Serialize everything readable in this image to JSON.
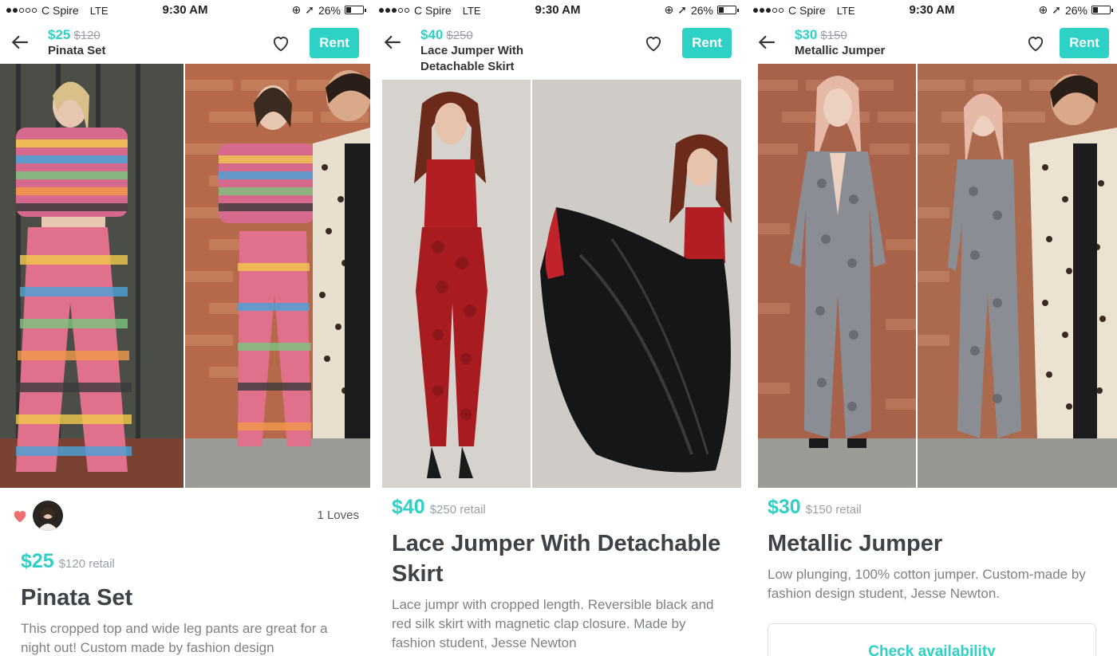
{
  "status_bar": {
    "carrier": "C Spire",
    "network": "LTE",
    "time": "9:30 AM",
    "battery": "26%",
    "battery_level": 0.26
  },
  "accent_color": "#2ed1c6",
  "screens": [
    {
      "nav": {
        "price": "$25",
        "retail": "$120",
        "name": "Pinata Set",
        "rent_label": "Rent"
      },
      "loves": {
        "count_label": "1 Loves"
      },
      "detail": {
        "price": "$25",
        "retail": "$120 retail",
        "title": "Pinata Set",
        "description": "This cropped top and wide leg pants are great for a night out!  Custom made by fashion design"
      }
    },
    {
      "nav": {
        "price": "$40",
        "retail": "$250",
        "name": "Lace Jumper With Detachable Skirt",
        "rent_label": "Rent"
      },
      "detail": {
        "price": "$40",
        "retail": "$250 retail",
        "title": "Lace Jumper With Detachable Skirt",
        "description": "Lace jumpr with cropped length. Reversible black and red silk skirt with magnetic clap closure. Made by fashion student, Jesse Newton"
      }
    },
    {
      "nav": {
        "price": "$30",
        "retail": "$150",
        "name": "Metallic Jumper",
        "rent_label": "Rent"
      },
      "detail": {
        "price": "$30",
        "retail": "$150 retail",
        "title": "Metallic Jumper",
        "description": "Low plunging, 100% cotton jumper. Custom-made by fashion design student, Jesse Newton."
      },
      "cta": {
        "label": "Check availability"
      }
    }
  ]
}
